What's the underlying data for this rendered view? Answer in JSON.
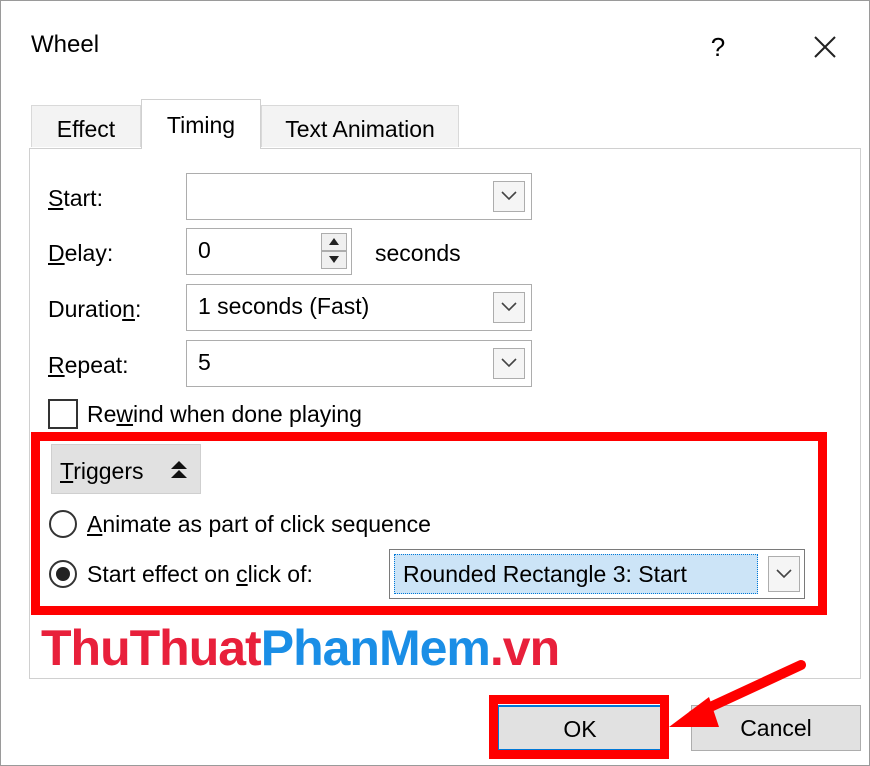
{
  "window": {
    "title": "Wheel",
    "help": "?"
  },
  "tabs": [
    {
      "label": "Effect",
      "active": false
    },
    {
      "label": "Timing",
      "active": true
    },
    {
      "label": "Text Animation",
      "active": false
    }
  ],
  "timing": {
    "start": {
      "label_u": "S",
      "label_rest": "tart:",
      "value": ""
    },
    "delay": {
      "label_u": "D",
      "label_rest": "elay:",
      "value": "0",
      "unit": "seconds"
    },
    "duration": {
      "label_pre": "Duratio",
      "label_u": "n",
      "label_rest": ":",
      "value": "1 seconds (Fast)"
    },
    "repeat": {
      "label_u": "R",
      "label_rest": "epeat:",
      "value": "5"
    },
    "rewind": {
      "label_pre": "Re",
      "label_u": "w",
      "label_rest": "ind when done playing",
      "checked": false
    }
  },
  "triggers": {
    "button_u": "T",
    "button_rest": "riggers",
    "option1": {
      "label_u": "A",
      "label_rest": "nimate as part of click sequence",
      "selected": false
    },
    "option2": {
      "label_pre": "Start effect on ",
      "label_u": "c",
      "label_rest": "lick of:",
      "selected": true
    },
    "click_target": "Rounded Rectangle 3: Start"
  },
  "watermark": {
    "part1": "ThuThuat",
    "part2": "PhanMem",
    "part3": ".vn"
  },
  "buttons": {
    "ok": "OK",
    "cancel": "Cancel"
  },
  "colors": {
    "highlight": "#ff0000",
    "selection": "#cce4f7",
    "accent": "#0078d7"
  }
}
